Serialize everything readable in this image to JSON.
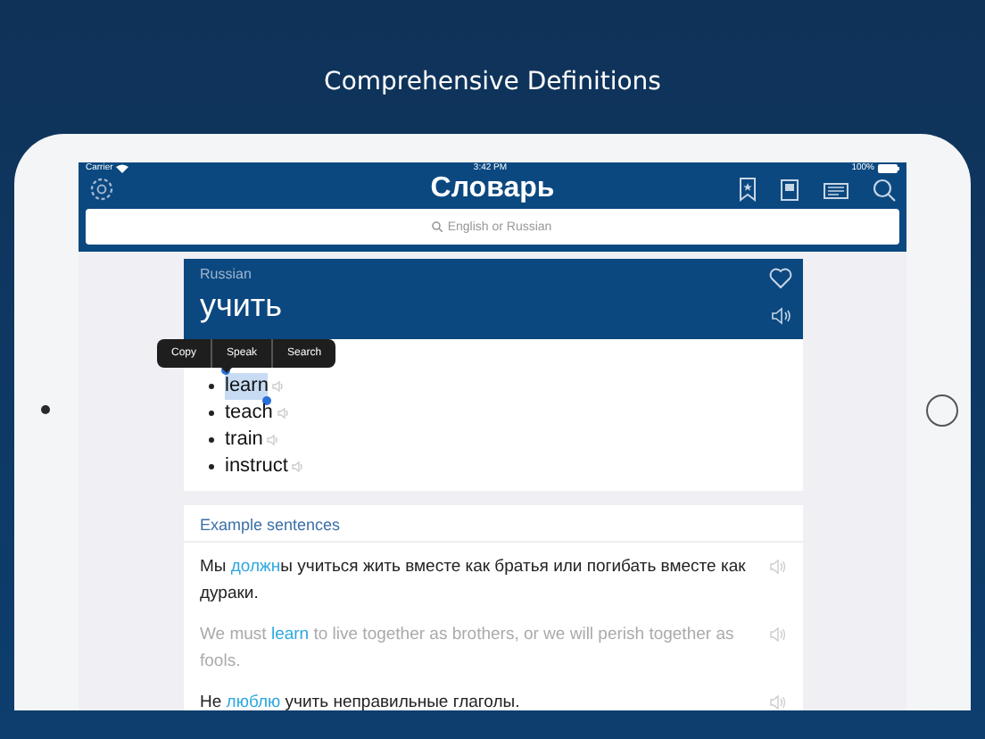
{
  "hero": {
    "title": "Comprehensive Definitions"
  },
  "status_bar": {
    "carrier": "Carrier",
    "time": "3:42 PM",
    "battery": "100%"
  },
  "nav_bar": {
    "title": "Словарь"
  },
  "search": {
    "placeholder": "English or Russian"
  },
  "entry": {
    "language": "Russian",
    "headword": "учить",
    "translations": [
      {
        "text": "learn",
        "selected": true
      },
      {
        "text": "teach",
        "selected": false
      },
      {
        "text": "train",
        "selected": false
      },
      {
        "text": "instruct",
        "selected": false
      }
    ]
  },
  "context_menu": {
    "items": [
      "Copy",
      "Speak",
      "Search"
    ]
  },
  "examples": {
    "title": "Example sentences",
    "sentences": [
      {
        "kind": "russian",
        "segments": [
          {
            "text": "Мы ",
            "highlight": false
          },
          {
            "text": "должн",
            "highlight": true
          },
          {
            "text": "ы учиться жить вместе как братья или погибать вместе как дураки.",
            "highlight": false
          }
        ]
      },
      {
        "kind": "english",
        "segments": [
          {
            "text": "We must ",
            "highlight": false
          },
          {
            "text": "learn",
            "highlight": true
          },
          {
            "text": " to live together as brothers, or we will perish together as fools.",
            "highlight": false
          }
        ]
      },
      {
        "kind": "russian",
        "segments": [
          {
            "text": "Не ",
            "highlight": false
          },
          {
            "text": "люблю",
            "highlight": true
          },
          {
            "text": " учить неправильные глаголы.",
            "highlight": false
          }
        ]
      }
    ]
  }
}
